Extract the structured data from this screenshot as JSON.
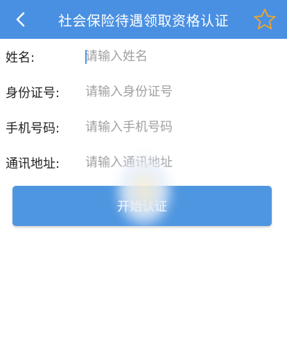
{
  "header": {
    "title": "社会保险待遇领取资格认证",
    "back_icon": "chevron-left-icon",
    "favorite_icon": "star-outline-icon",
    "background_color": "#4a90e2",
    "star_color": "#f5a623"
  },
  "form": {
    "fields": [
      {
        "label": "姓名:",
        "placeholder": "请输入姓名",
        "value": ""
      },
      {
        "label": "身份证号:",
        "placeholder": "请输入身份证号",
        "value": ""
      },
      {
        "label": "手机号码:",
        "placeholder": "请输入手机号码",
        "value": ""
      },
      {
        "label": "通讯地址:",
        "placeholder": "请输入通讯地址",
        "value": ""
      }
    ]
  },
  "submit": {
    "label": "开始认证",
    "color": "#4f96e0"
  }
}
